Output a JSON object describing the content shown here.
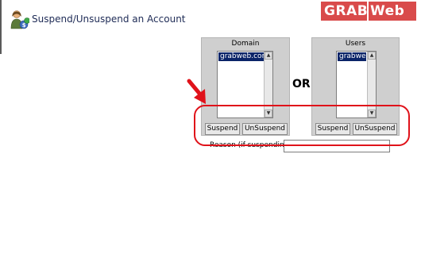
{
  "header": {
    "title": "Suspend/Unsuspend an Account",
    "icon": "users-accounts-icon"
  },
  "logo": {
    "part1": "GRAB",
    "part2": "Web",
    "color": "#d94b4b"
  },
  "domain_panel": {
    "header": "Domain",
    "options": [
      "grabweb.com"
    ],
    "selected": "grabweb.com",
    "suspend_label": "Suspend",
    "unsuspend_label": "UnSuspend"
  },
  "separator": {
    "label": "OR"
  },
  "users_panel": {
    "header": "Users",
    "options": [
      "grabweb"
    ],
    "selected": "grabweb",
    "suspend_label": "Suspend",
    "unsuspend_label": "UnSuspend"
  },
  "reason": {
    "label": "Reason (if suspending):",
    "value": "",
    "placeholder": ""
  },
  "annotation": {
    "color": "#e0121a",
    "arrow_icon": "red-arrow-icon"
  },
  "colors": {
    "panel_bg": "#cfcfcf",
    "selection_bg": "#0a2468",
    "title": "#1d2a55"
  }
}
